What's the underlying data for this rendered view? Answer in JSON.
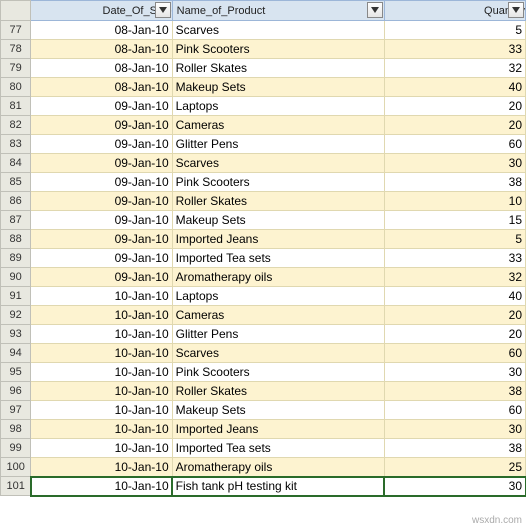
{
  "headers": {
    "date": "Date_Of_Sale",
    "product": "Name_of_Product",
    "quantity": "Quantity"
  },
  "rows": [
    {
      "num": "77",
      "date": "08-Jan-10",
      "product": "Scarves",
      "qty": "5"
    },
    {
      "num": "78",
      "date": "08-Jan-10",
      "product": "Pink Scooters",
      "qty": "33"
    },
    {
      "num": "79",
      "date": "08-Jan-10",
      "product": "Roller Skates",
      "qty": "32"
    },
    {
      "num": "80",
      "date": "08-Jan-10",
      "product": "Makeup Sets",
      "qty": "40"
    },
    {
      "num": "81",
      "date": "09-Jan-10",
      "product": "Laptops",
      "qty": "20"
    },
    {
      "num": "82",
      "date": "09-Jan-10",
      "product": "Cameras",
      "qty": "20"
    },
    {
      "num": "83",
      "date": "09-Jan-10",
      "product": "Glitter Pens",
      "qty": "60"
    },
    {
      "num": "84",
      "date": "09-Jan-10",
      "product": "Scarves",
      "qty": "30"
    },
    {
      "num": "85",
      "date": "09-Jan-10",
      "product": "Pink Scooters",
      "qty": "38"
    },
    {
      "num": "86",
      "date": "09-Jan-10",
      "product": "Roller Skates",
      "qty": "10"
    },
    {
      "num": "87",
      "date": "09-Jan-10",
      "product": "Makeup Sets",
      "qty": "15"
    },
    {
      "num": "88",
      "date": "09-Jan-10",
      "product": "Imported Jeans",
      "qty": "5"
    },
    {
      "num": "89",
      "date": "09-Jan-10",
      "product": "Imported Tea sets",
      "qty": "33"
    },
    {
      "num": "90",
      "date": "09-Jan-10",
      "product": "Aromatherapy oils",
      "qty": "32"
    },
    {
      "num": "91",
      "date": "10-Jan-10",
      "product": "Laptops",
      "qty": "40"
    },
    {
      "num": "92",
      "date": "10-Jan-10",
      "product": "Cameras",
      "qty": "20"
    },
    {
      "num": "93",
      "date": "10-Jan-10",
      "product": "Glitter Pens",
      "qty": "20"
    },
    {
      "num": "94",
      "date": "10-Jan-10",
      "product": "Scarves",
      "qty": "60"
    },
    {
      "num": "95",
      "date": "10-Jan-10",
      "product": "Pink Scooters",
      "qty": "30"
    },
    {
      "num": "96",
      "date": "10-Jan-10",
      "product": "Roller Skates",
      "qty": "38"
    },
    {
      "num": "97",
      "date": "10-Jan-10",
      "product": "Makeup Sets",
      "qty": "60"
    },
    {
      "num": "98",
      "date": "10-Jan-10",
      "product": "Imported Jeans",
      "qty": "30"
    },
    {
      "num": "99",
      "date": "10-Jan-10",
      "product": "Imported Tea sets",
      "qty": "38"
    },
    {
      "num": "100",
      "date": "10-Jan-10",
      "product": "Aromatherapy oils",
      "qty": "25"
    },
    {
      "num": "101",
      "date": "10-Jan-10",
      "product": "Fish tank pH testing kit",
      "qty": "30"
    }
  ],
  "watermark": "wsxdn.com",
  "active_row": "101"
}
